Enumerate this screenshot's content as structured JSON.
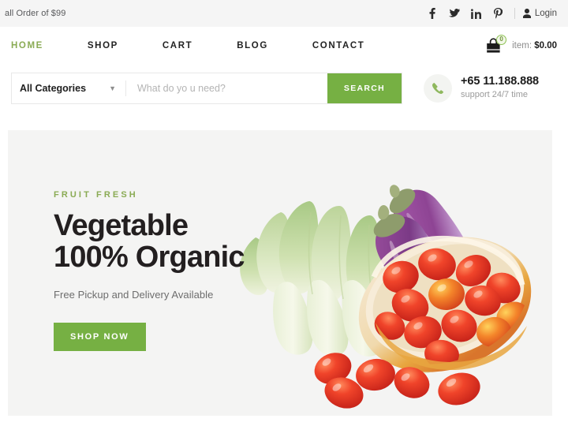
{
  "topbar": {
    "promo_text": "all Order of $99",
    "social": [
      {
        "name": "facebook-icon",
        "glyph": "f"
      },
      {
        "name": "twitter-icon",
        "glyph": "t"
      },
      {
        "name": "linkedin-icon",
        "glyph": "in"
      },
      {
        "name": "pinterest-icon",
        "glyph": "P"
      }
    ],
    "login_label": "Login"
  },
  "header": {
    "nav": [
      {
        "label": "HOME",
        "active": true
      },
      {
        "label": "SHOP",
        "active": false
      },
      {
        "label": "CART",
        "active": false
      },
      {
        "label": "BLOG",
        "active": false
      },
      {
        "label": "CONTACT",
        "active": false
      }
    ],
    "cart": {
      "badge_count": "0",
      "label": "item:",
      "amount": "$0.00"
    }
  },
  "search": {
    "category_label": "All Categories",
    "placeholder": "What do yo u need?",
    "input_value": "",
    "button_label": "SEARCH"
  },
  "support": {
    "phone": "+65 11.188.888",
    "note": "support 24/7 time"
  },
  "hero": {
    "eyebrow": "FRUIT FRESH",
    "title_line1": "Vegetable",
    "title_line2": "100% Organic",
    "subtitle": "Free Pickup and Delivery Available",
    "cta_label": "SHOP NOW",
    "image_alt": "bok choy, purple eggplants and a bowl of cherry tomatoes"
  },
  "colors": {
    "accent_green": "#76b043",
    "eyebrow_green": "#8aab54",
    "hero_bg": "#f4f4f3",
    "topbar_bg": "#f5f5f5"
  }
}
